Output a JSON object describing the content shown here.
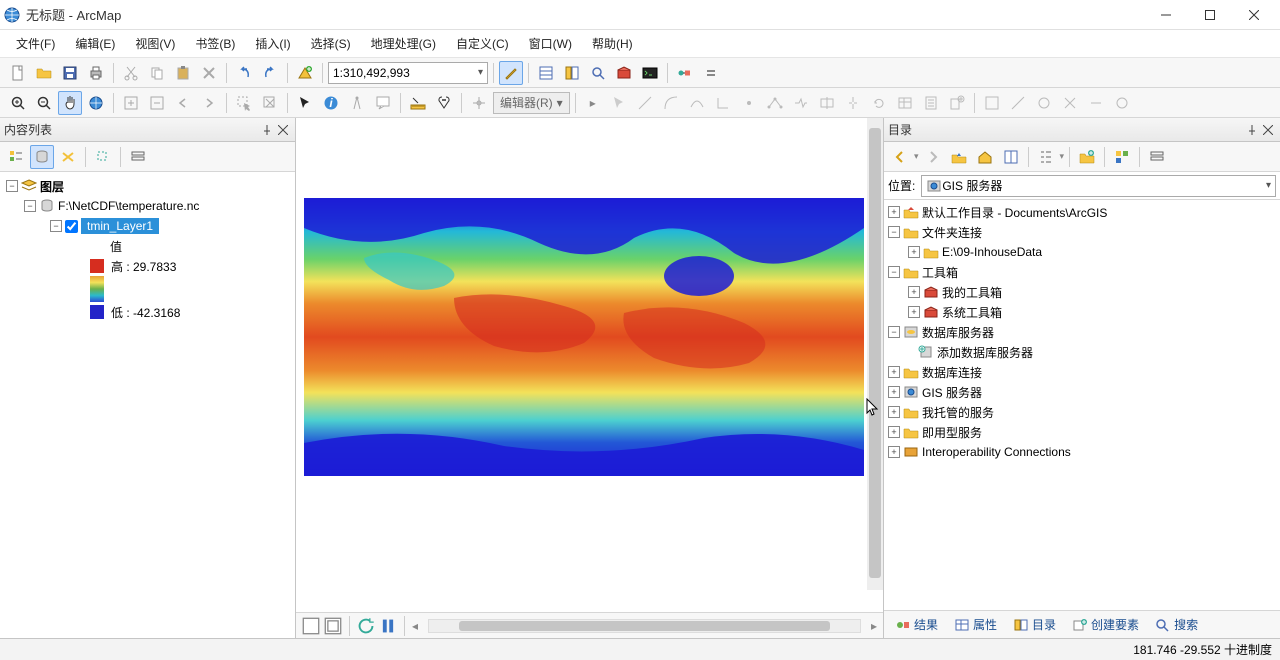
{
  "window": {
    "title": "无标题 - ArcMap"
  },
  "menu": {
    "file": "文件(F)",
    "edit": "编辑(E)",
    "view": "视图(V)",
    "bookmark": "书签(B)",
    "insert": "插入(I)",
    "select": "选择(S)",
    "geoproc": "地理处理(G)",
    "custom": "自定义(C)",
    "window": "窗口(W)",
    "help": "帮助(H)"
  },
  "toolbar1": {
    "scale": "1:310,492,993"
  },
  "toolbar2": {
    "editor": "编辑器(R)"
  },
  "toc": {
    "title": "内容列表",
    "root": "图层",
    "dataset": "F:\\NetCDF\\temperature.nc",
    "layer": "tmin_Layer1",
    "value_label": "值",
    "high": "高 : 29.7833",
    "low": "低 : -42.3168"
  },
  "catalog": {
    "title": "目录",
    "loc_label": "位置:",
    "loc_value": "GIS 服务器",
    "tree": {
      "home": "默认工作目录 - Documents\\ArcGIS",
      "folders": "文件夹连接",
      "folder1": "E:\\09-InhouseData",
      "toolboxes": "工具箱",
      "my_tb": "我的工具箱",
      "sys_tb": "系统工具箱",
      "db_servers": "数据库服务器",
      "add_db": "添加数据库服务器",
      "db_conn": "数据库连接",
      "gis_servers": "GIS 服务器",
      "hosted": "我托管的服务",
      "ready": "即用型服务",
      "interop": "Interoperability Connections"
    },
    "tabs": {
      "result": "结果",
      "attr": "属性",
      "catalog": "目录",
      "create": "创建要素",
      "search": "搜索"
    }
  },
  "status": {
    "coords": "181.746  -29.552 十进制度"
  }
}
